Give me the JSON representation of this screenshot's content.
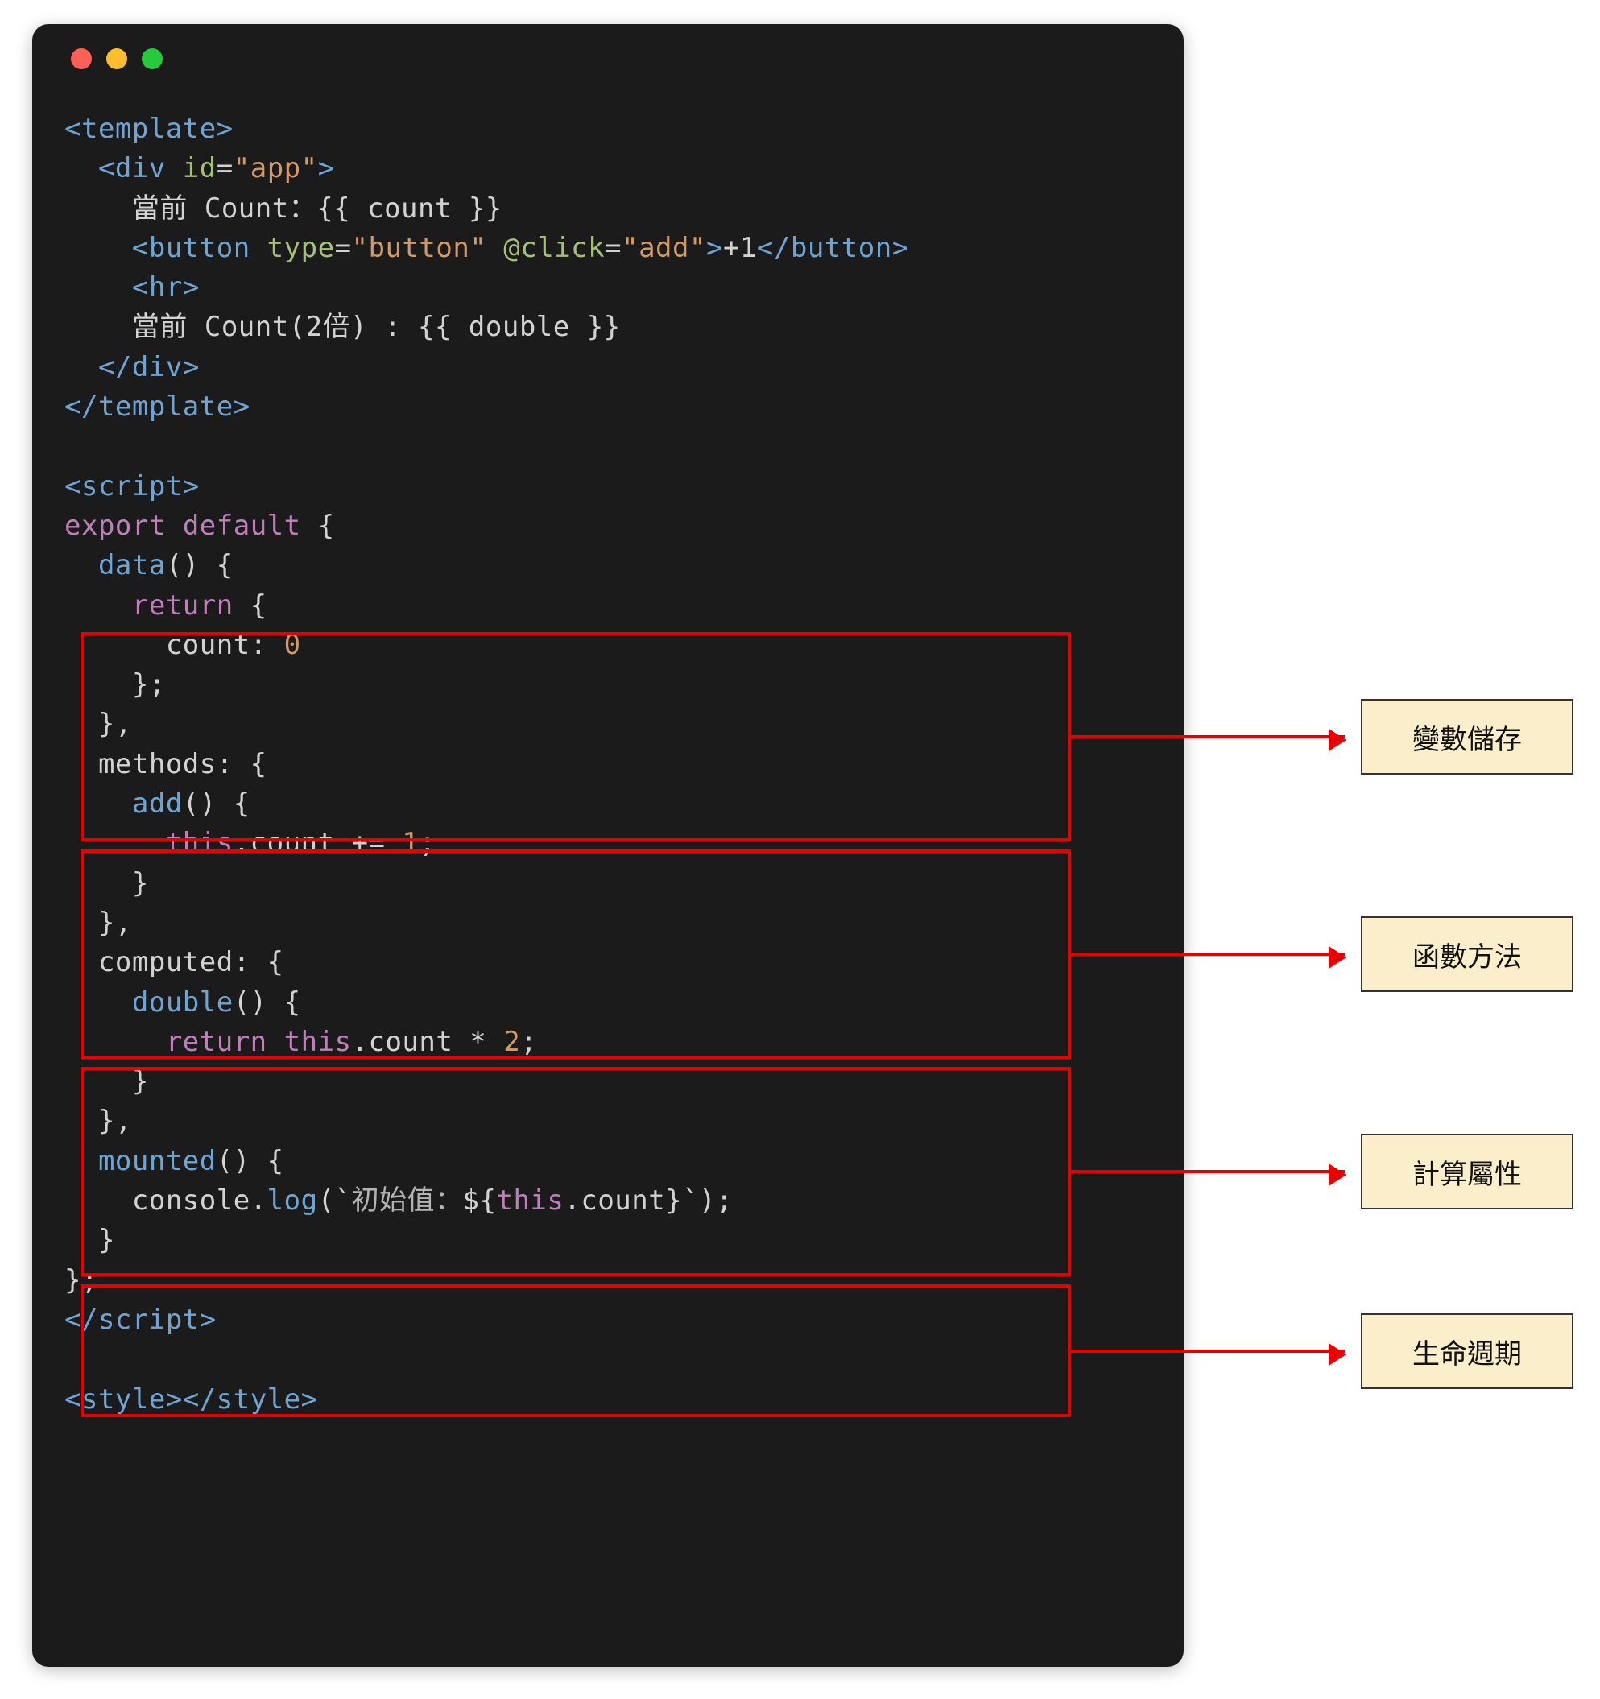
{
  "code": {
    "l01_open_template": "<template>",
    "l02_div_open_1": "  <",
    "l02_div_tag": "div",
    "l02_sp": " ",
    "l02_attr_id": "id",
    "l02_eq": "=",
    "l02_str_app": "\"app\"",
    "l02_close": ">",
    "l03_text": "    當前 Count：{{ count }}",
    "l04_open": "    <",
    "l04_btn": "button",
    "l04_sp1": " ",
    "l04_attr_type": "type",
    "l04_eq1": "=",
    "l04_str_btn": "\"button\"",
    "l04_sp2": " ",
    "l04_attr_click": "@click",
    "l04_eq2": "=",
    "l04_str_add": "\"add\"",
    "l04_closeopen": ">",
    "l04_inner": "+1",
    "l04_closetag_open": "</",
    "l04_closetag_name": "button",
    "l04_closetag_close": ">",
    "l05_hr_open": "    <",
    "l05_hr": "hr",
    "l05_hr_close": ">",
    "l06_text": "    當前 Count(2倍) : {{ double }}",
    "l07_div_close_open": "  </",
    "l07_div_close_name": "div",
    "l07_div_close_close": ">",
    "l08_close_template": "</template>",
    "blank": "",
    "l10_open_script": "<script>",
    "l11_export": "export",
    "l11_sp": " ",
    "l11_default": "default",
    "l11_rest": " {",
    "l12_data": "  data",
    "l12_rest": "() {",
    "l13_return": "    return",
    "l13_rest": " {",
    "l14_count_key": "      count",
    "l14_colon": ": ",
    "l14_zero": "0",
    "l15": "    };",
    "l16": "  },",
    "l17_methods": "  methods",
    "l17_rest": ": {",
    "l18_add": "    add",
    "l18_rest": "() {",
    "l19_this": "      this",
    "l19_rest": ".count += ",
    "l19_one": "1",
    "l19_semi": ";",
    "l20": "    }",
    "l21": "  },",
    "l22_computed": "  computed",
    "l22_rest": ": {",
    "l23_double": "    double",
    "l23_rest": "() {",
    "l24_return": "      return",
    "l24_sp": " ",
    "l24_this": "this",
    "l24_rest": ".count * ",
    "l24_two": "2",
    "l24_semi": ";",
    "l25": "    }",
    "l26": "  },",
    "l27_mounted": "  mounted",
    "l27_rest": "() {",
    "l28_console": "    console",
    "l28_dot": ".",
    "l28_log": "log",
    "l28_rest_open": "(`",
    "l28_tpl_text": "初始值：",
    "l28_tpl_interp_open": "${",
    "l28_tpl_this": "this",
    "l28_tpl_rest": ".count",
    "l28_tpl_interp_close": "}",
    "l28_rest_close": "`);",
    "l29": "  }",
    "l30": "};",
    "l31_close_script_open": "</",
    "l31_close_script_name": "script",
    "l31_close_script_close": ">",
    "l33_style_open_open": "<",
    "l33_style_open_name": "style",
    "l33_style_open_close": ">",
    "l33_style_close_open": "</",
    "l33_style_close_name": "style",
    "l33_style_close_close": ">"
  },
  "labels": {
    "data": "變數儲存",
    "methods": "函數方法",
    "computed": "計算屬性",
    "mounted": "生命週期"
  }
}
